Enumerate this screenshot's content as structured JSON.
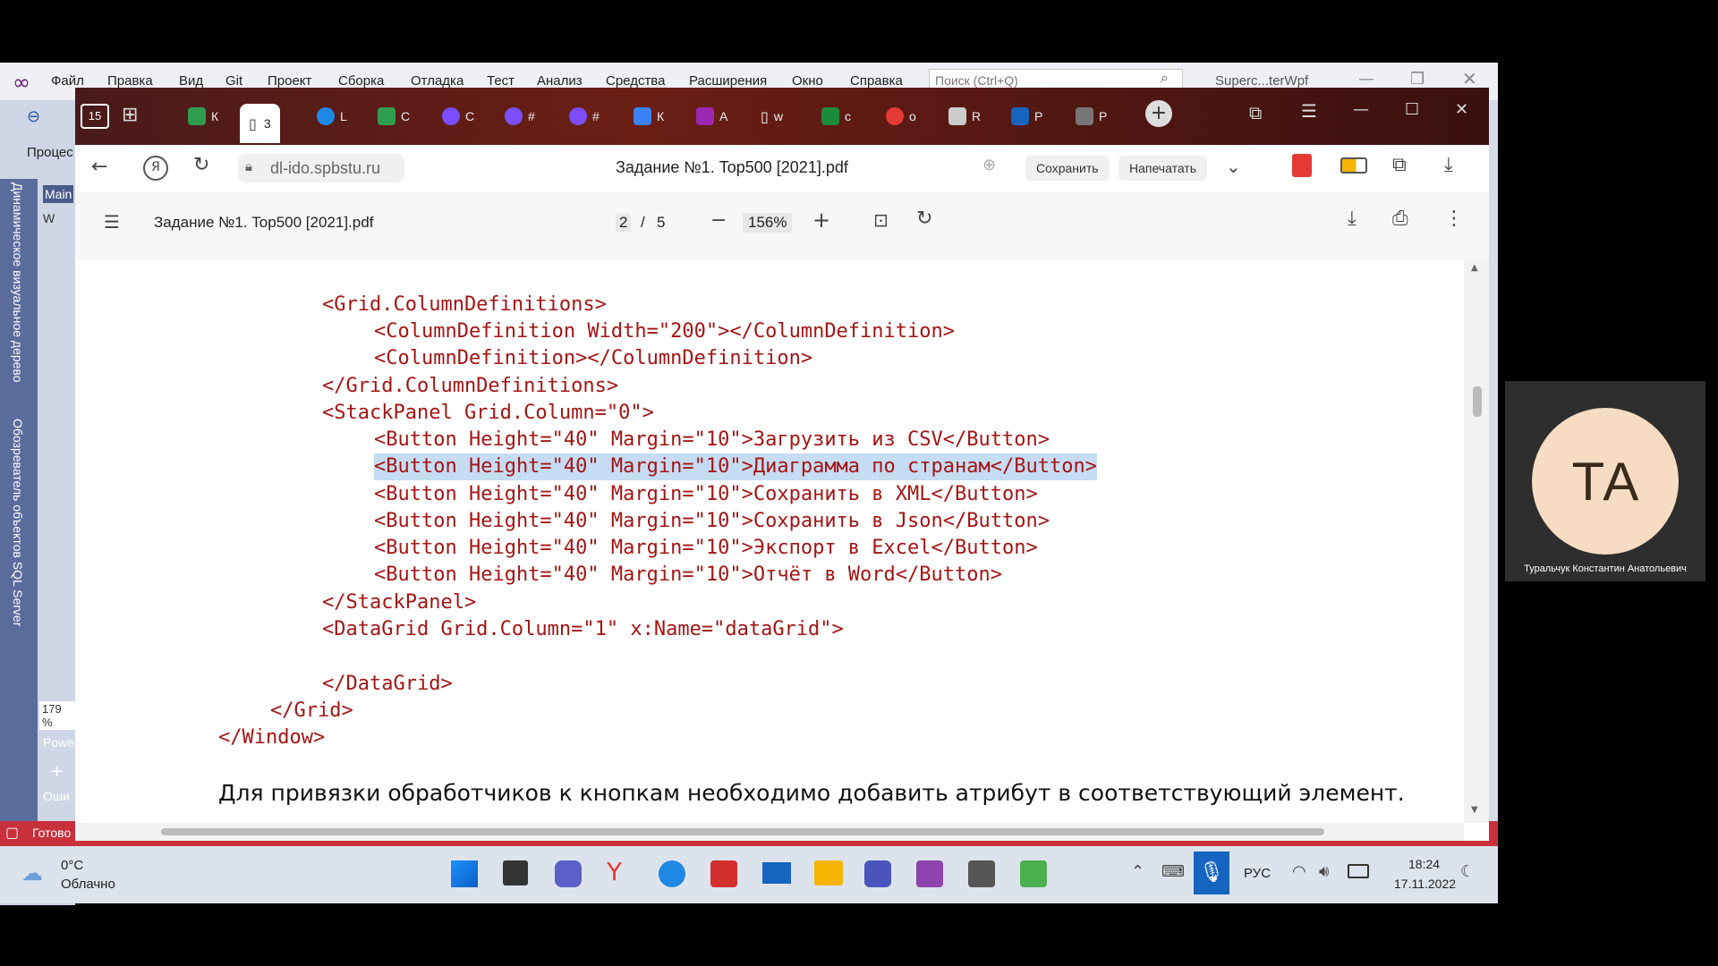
{
  "vs": {
    "menu": [
      "Файл",
      "Правка",
      "Вид",
      "Git",
      "Проект",
      "Сборка",
      "Отладка",
      "Тест",
      "Анализ",
      "Средства",
      "Расширения",
      "Окно",
      "Справка"
    ],
    "search_placeholder": "Поиск (Ctrl+Q)",
    "solution_name": "Superc...terWpf",
    "left_labels": [
      "Процес",
      "Main",
      "W",
      "179 %",
      "Powe",
      "Оши",
      "Готово"
    ],
    "vertical_tabs": [
      "Динамическое визуальное дерево",
      "Обозреватель объектов SQL Server"
    ]
  },
  "browser": {
    "tab_counter": "15",
    "tabs": [
      {
        "letter": "К",
        "color": "#2e9e4e"
      },
      {
        "letter": "3",
        "color": "#ffffff",
        "active": true
      },
      {
        "letter": "L",
        "color": "#1e88e5"
      },
      {
        "letter": "С",
        "color": "#2e9e4e"
      },
      {
        "letter": "С",
        "color": "#7c4dff"
      },
      {
        "letter": "#",
        "color": "#7c4dff"
      },
      {
        "letter": "#",
        "color": "#7c4dff"
      },
      {
        "letter": "К",
        "color": "#3b82f6"
      },
      {
        "letter": "А",
        "color": "#9c27b0"
      },
      {
        "letter": "w",
        "color": "#ffffff"
      },
      {
        "letter": "с",
        "color": "#1b8a3a"
      },
      {
        "letter": "о",
        "color": "#e53935"
      },
      {
        "letter": "R",
        "color": "#cccccc"
      },
      {
        "letter": "Р",
        "color": "#1565c0"
      },
      {
        "letter": "Р",
        "color": "#777777"
      }
    ],
    "url": "dl-ido.spbstu.ru",
    "doc_title": "Задание №1. Top500 [2021].pdf",
    "save_label": "Сохранить",
    "print_label": "Напечатать"
  },
  "pdf": {
    "filename": "Задание №1. Top500 [2021].pdf",
    "page_current": "2",
    "page_sep": "/",
    "page_total": "5",
    "zoom": "156%",
    "code_lines": [
      "<Grid.ColumnDefinitions>",
      "<ColumnDefinition Width=\"200\"></ColumnDefinition>",
      "<ColumnDefinition></ColumnDefinition>",
      "</Grid.ColumnDefinitions>",
      "<StackPanel Grid.Column=\"0\">",
      "<Button Height=\"40\" Margin=\"10\">Загрузить из CSV</Button>",
      "<Button Height=\"40\" Margin=\"10\">Диаграмма по странам</Button>",
      "<Button Height=\"40\" Margin=\"10\">Сохранить в XML</Button>",
      "<Button Height=\"40\" Margin=\"10\">Сохранить в Json</Button>",
      "<Button Height=\"40\" Margin=\"10\">Экспорт в Excel</Button>",
      "<Button Height=\"40\" Margin=\"10\">Отчёт в Word</Button>",
      "</StackPanel>",
      "<DataGrid Grid.Column=\"1\" x:Name=\"dataGrid\">",
      "</DataGrid>",
      "</Grid>",
      "</Window>"
    ],
    "paragraph": "Для привязки обработчиков к кнопкам необходимо добавить атрибут в соответствующий элемент."
  },
  "taskbar": {
    "temp": "0°C",
    "weather": "Облачно",
    "lang": "РУС",
    "time": "18:24",
    "date": "17.11.2022"
  },
  "cam": {
    "initials": "ТА",
    "name": "Туральчук Константин Анатольевич"
  }
}
